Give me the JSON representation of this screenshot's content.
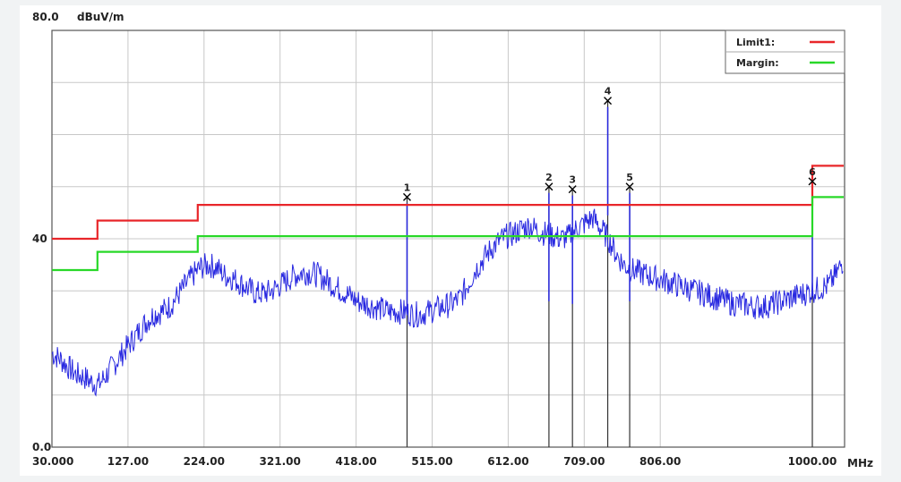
{
  "chart_data": {
    "type": "line",
    "yunit": "dBuV/m",
    "xunit": "MHz",
    "xlim": [
      30,
      1000
    ],
    "ylim": [
      0,
      80
    ],
    "yticks": [
      0,
      40,
      80
    ],
    "ytick_labels": [
      "0.0",
      "40",
      "80.0"
    ],
    "xticks": [
      30,
      127,
      224,
      321,
      418,
      515,
      612,
      709,
      806,
      1000
    ],
    "xtick_labels": [
      "30.000",
      "127.00",
      "224.00",
      "321.00",
      "418.00",
      "515.00",
      "612.00",
      "709.00",
      "806.00",
      "1000.00"
    ],
    "grid": true,
    "legend_position": "top-right",
    "colors": {
      "limit": "#e8262a",
      "margin": "#28d828",
      "trace": "#2828e0",
      "markers": "#000000",
      "grid": "#c8c8c8"
    },
    "series": [
      {
        "name": "Limit1:",
        "color": "#e8262a",
        "step_x": [
          30,
          88,
          88,
          216,
          216,
          1000,
          1000,
          1040
        ],
        "step_y": [
          40,
          40,
          43.5,
          43.5,
          46.5,
          46.5,
          54,
          54
        ]
      },
      {
        "name": "Margin:",
        "color": "#28d828",
        "step_x": [
          30,
          88,
          88,
          216,
          216,
          1000,
          1000,
          1040
        ],
        "step_y": [
          34,
          34,
          37.5,
          37.5,
          40.5,
          40.5,
          48,
          48
        ]
      },
      {
        "color": "#2828e0",
        "x": [
          30,
          40,
          50,
          60,
          70,
          80,
          90,
          100,
          110,
          120,
          130,
          140,
          150,
          160,
          170,
          180,
          190,
          200,
          210,
          220,
          230,
          240,
          250,
          260,
          270,
          280,
          290,
          300,
          310,
          320,
          330,
          340,
          350,
          360,
          370,
          380,
          390,
          400,
          410,
          420,
          430,
          440,
          450,
          460,
          470,
          480,
          490,
          500,
          510,
          520,
          530,
          540,
          550,
          560,
          570,
          580,
          590,
          600,
          610,
          620,
          630,
          640,
          650,
          660,
          670,
          680,
          690,
          700,
          710,
          720,
          730,
          740,
          750,
          760,
          770,
          780,
          790,
          800,
          810,
          820,
          830,
          840,
          850,
          860,
          870,
          880,
          890,
          900,
          910,
          920,
          930,
          940,
          950,
          960,
          970,
          980,
          990,
          1000,
          1010,
          1020,
          1030,
          1040
        ],
        "y": [
          18,
          17,
          15.5,
          14,
          13.5,
          12.5,
          12,
          14,
          16,
          18,
          20,
          22,
          24,
          25.5,
          26,
          27,
          29,
          31,
          33,
          34.5,
          35,
          34.5,
          33,
          32.5,
          31.5,
          30.5,
          29.5,
          29.5,
          30,
          31,
          32,
          33,
          33.5,
          33.5,
          33,
          32,
          31,
          30,
          29,
          28,
          27.5,
          27,
          26.5,
          26,
          26,
          26,
          25.5,
          25.5,
          26,
          26.5,
          27,
          27.5,
          28.5,
          31,
          34,
          36,
          38,
          39.5,
          40.5,
          41,
          42,
          42.5,
          41.5,
          41,
          40.5,
          40,
          40.5,
          42,
          43,
          44,
          42,
          40,
          37,
          35,
          34,
          33.5,
          33,
          32.5,
          32,
          31.5,
          31,
          30.5,
          30,
          29.5,
          29,
          28.5,
          28,
          27.5,
          27.5,
          27,
          27,
          27,
          27.5,
          28,
          28.5,
          29,
          29.5,
          30,
          30.5,
          31,
          33,
          36
        ]
      }
    ],
    "markers": [
      {
        "label": "1",
        "x": 483,
        "y": 48
      },
      {
        "label": "2",
        "x": 664,
        "y": 50
      },
      {
        "label": "3",
        "x": 694,
        "y": 49.5
      },
      {
        "label": "4",
        "x": 739,
        "y": 66.5
      },
      {
        "label": "5",
        "x": 767,
        "y": 50
      },
      {
        "label": "6",
        "x": 1000,
        "y": 51
      }
    ]
  }
}
